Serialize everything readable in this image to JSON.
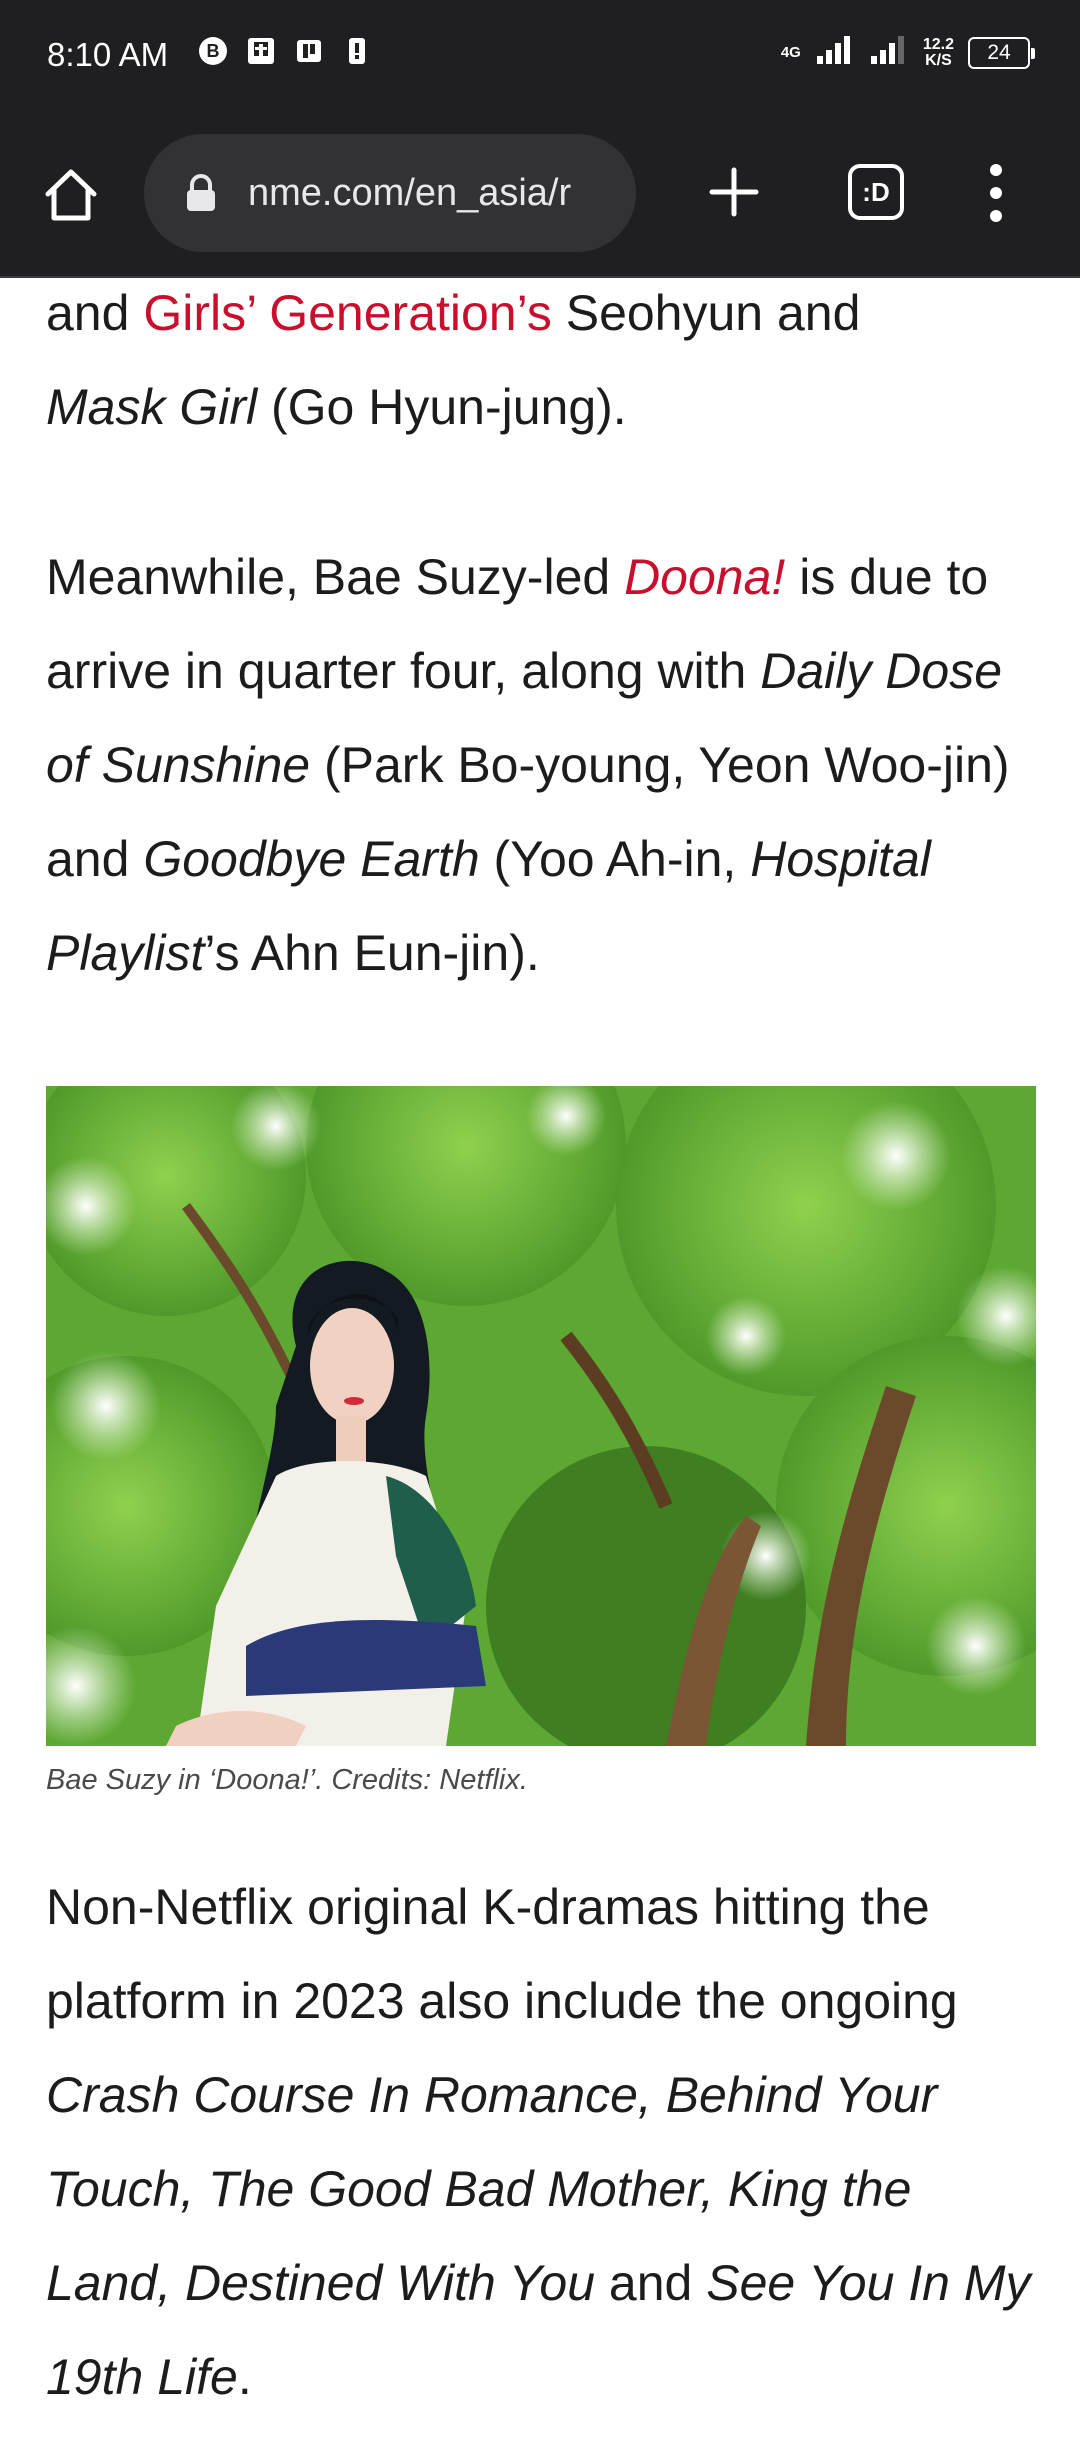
{
  "status_bar": {
    "time": "8:10 AM",
    "network_type": "4G",
    "speed_value": "12.2",
    "speed_unit": "K/S",
    "battery": "24",
    "icons": [
      "b-circle-icon",
      "tv-icon",
      "paytm-icon",
      "notification-icon",
      "signal-icon",
      "signal-icon"
    ]
  },
  "browser": {
    "url": "nme.com/en_asia/r",
    "tabs_label": ":D",
    "icons": [
      "home-icon",
      "lock-icon",
      "plus-icon",
      "tabs-icon",
      "menu-icon"
    ]
  },
  "article": {
    "p1": {
      "s1": "and ",
      "s2": "Girls’ Generation’s",
      "s3": " Seohyun and",
      "s4": "Mask Girl",
      "s5": " (Go Hyun-jung)."
    },
    "p2": {
      "s1": "Meanwhile, Bae Suzy-led ",
      "s2": "Doona!",
      "s3": " is due to arrive in quarter four, along with ",
      "s4": "Daily Dose of Sunshine",
      "s5": " (Park Bo-young, Yeon Woo-jin) and ",
      "s6": "Goodbye Earth",
      "s7": " (Yoo Ah-in, ",
      "s8": "Hospital Playlist",
      "s9": "’s Ahn Eun-jin)."
    },
    "figure": {
      "caption": "Bae Suzy in ‘Doona!’. Credits: Netflix."
    },
    "p3": {
      "s1": "Non-Netflix original K-dramas hitting the platform in 2023 also include the ongoing ",
      "s2": "Crash Course In Romance, Behind Your Touch, The Good Bad Mother, King the Land, Destined With You",
      "s3": " and ",
      "s4": "See You In My 19th Life",
      "s5": "."
    }
  },
  "colors": {
    "link": "#c8102e",
    "toolbar_bg": "#1f1f21",
    "urlbar_bg": "#323236"
  }
}
